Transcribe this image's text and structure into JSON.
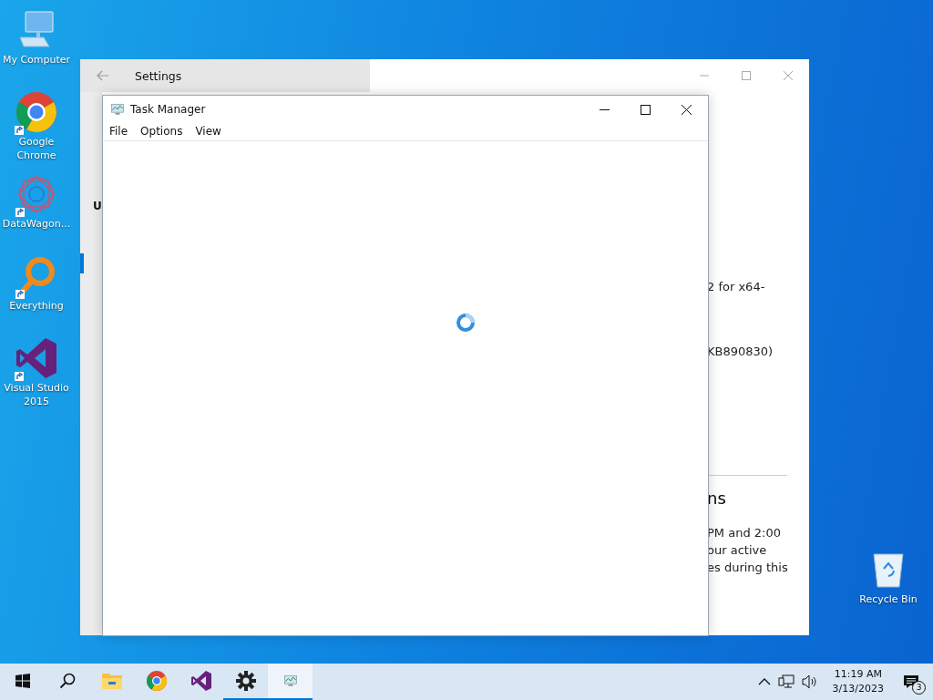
{
  "desktop_icons": [
    {
      "kind": "computer",
      "label": "My Computer",
      "shortcut": false
    },
    {
      "kind": "chrome",
      "label": "Google Chrome",
      "shortcut": true
    },
    {
      "kind": "datawagon",
      "label": "DataWagon...",
      "shortcut": true
    },
    {
      "kind": "everything",
      "label": "Everything",
      "shortcut": true
    },
    {
      "kind": "vs",
      "label": "Visual Studio 2015",
      "shortcut": true
    }
  ],
  "recycle_bin": {
    "label": "Recycle Bin"
  },
  "settings_window": {
    "title": "Settings",
    "sidebar_heading": "U",
    "fragments": [
      {
        "kind": "body",
        "text": "2 for x64-"
      },
      {
        "kind": "body",
        "text": "KB890830)"
      },
      {
        "kind": "heading",
        "text": "ns"
      },
      {
        "kind": "body",
        "text": "PM and 2:00"
      },
      {
        "kind": "body",
        "text": "our active"
      },
      {
        "kind": "body",
        "text": "es during this"
      }
    ]
  },
  "task_manager": {
    "title": "Task Manager",
    "menu": [
      "File",
      "Options",
      "View"
    ],
    "loading": true
  },
  "taskbar": {
    "items": [
      {
        "kind": "start",
        "open": false,
        "active": false
      },
      {
        "kind": "search",
        "open": false,
        "active": false
      },
      {
        "kind": "explorer",
        "open": false,
        "active": false
      },
      {
        "kind": "chrome",
        "open": false,
        "active": false
      },
      {
        "kind": "vs",
        "open": false,
        "active": false
      },
      {
        "kind": "settings",
        "open": true,
        "active": false
      },
      {
        "kind": "taskmanager",
        "open": true,
        "active": true
      }
    ],
    "time": "11:19 AM",
    "date": "3/13/2023",
    "notifications": "3"
  }
}
